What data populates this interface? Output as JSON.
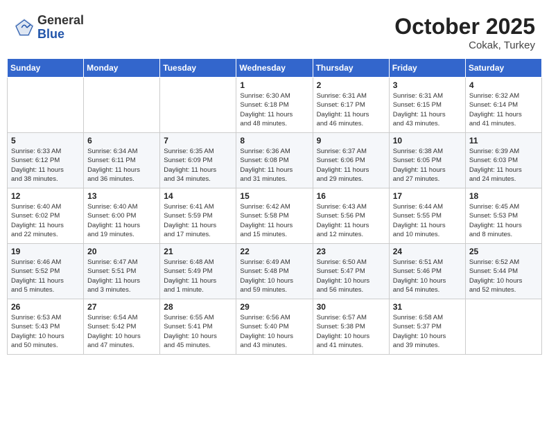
{
  "logo": {
    "general": "General",
    "blue": "Blue"
  },
  "title": "October 2025",
  "subtitle": "Cokak, Turkey",
  "days_of_week": [
    "Sunday",
    "Monday",
    "Tuesday",
    "Wednesday",
    "Thursday",
    "Friday",
    "Saturday"
  ],
  "weeks": [
    [
      {
        "day": "",
        "info": ""
      },
      {
        "day": "",
        "info": ""
      },
      {
        "day": "",
        "info": ""
      },
      {
        "day": "1",
        "info": "Sunrise: 6:30 AM\nSunset: 6:18 PM\nDaylight: 11 hours\nand 48 minutes."
      },
      {
        "day": "2",
        "info": "Sunrise: 6:31 AM\nSunset: 6:17 PM\nDaylight: 11 hours\nand 46 minutes."
      },
      {
        "day": "3",
        "info": "Sunrise: 6:31 AM\nSunset: 6:15 PM\nDaylight: 11 hours\nand 43 minutes."
      },
      {
        "day": "4",
        "info": "Sunrise: 6:32 AM\nSunset: 6:14 PM\nDaylight: 11 hours\nand 41 minutes."
      }
    ],
    [
      {
        "day": "5",
        "info": "Sunrise: 6:33 AM\nSunset: 6:12 PM\nDaylight: 11 hours\nand 38 minutes."
      },
      {
        "day": "6",
        "info": "Sunrise: 6:34 AM\nSunset: 6:11 PM\nDaylight: 11 hours\nand 36 minutes."
      },
      {
        "day": "7",
        "info": "Sunrise: 6:35 AM\nSunset: 6:09 PM\nDaylight: 11 hours\nand 34 minutes."
      },
      {
        "day": "8",
        "info": "Sunrise: 6:36 AM\nSunset: 6:08 PM\nDaylight: 11 hours\nand 31 minutes."
      },
      {
        "day": "9",
        "info": "Sunrise: 6:37 AM\nSunset: 6:06 PM\nDaylight: 11 hours\nand 29 minutes."
      },
      {
        "day": "10",
        "info": "Sunrise: 6:38 AM\nSunset: 6:05 PM\nDaylight: 11 hours\nand 27 minutes."
      },
      {
        "day": "11",
        "info": "Sunrise: 6:39 AM\nSunset: 6:03 PM\nDaylight: 11 hours\nand 24 minutes."
      }
    ],
    [
      {
        "day": "12",
        "info": "Sunrise: 6:40 AM\nSunset: 6:02 PM\nDaylight: 11 hours\nand 22 minutes."
      },
      {
        "day": "13",
        "info": "Sunrise: 6:40 AM\nSunset: 6:00 PM\nDaylight: 11 hours\nand 19 minutes."
      },
      {
        "day": "14",
        "info": "Sunrise: 6:41 AM\nSunset: 5:59 PM\nDaylight: 11 hours\nand 17 minutes."
      },
      {
        "day": "15",
        "info": "Sunrise: 6:42 AM\nSunset: 5:58 PM\nDaylight: 11 hours\nand 15 minutes."
      },
      {
        "day": "16",
        "info": "Sunrise: 6:43 AM\nSunset: 5:56 PM\nDaylight: 11 hours\nand 12 minutes."
      },
      {
        "day": "17",
        "info": "Sunrise: 6:44 AM\nSunset: 5:55 PM\nDaylight: 11 hours\nand 10 minutes."
      },
      {
        "day": "18",
        "info": "Sunrise: 6:45 AM\nSunset: 5:53 PM\nDaylight: 11 hours\nand 8 minutes."
      }
    ],
    [
      {
        "day": "19",
        "info": "Sunrise: 6:46 AM\nSunset: 5:52 PM\nDaylight: 11 hours\nand 5 minutes."
      },
      {
        "day": "20",
        "info": "Sunrise: 6:47 AM\nSunset: 5:51 PM\nDaylight: 11 hours\nand 3 minutes."
      },
      {
        "day": "21",
        "info": "Sunrise: 6:48 AM\nSunset: 5:49 PM\nDaylight: 11 hours\nand 1 minute."
      },
      {
        "day": "22",
        "info": "Sunrise: 6:49 AM\nSunset: 5:48 PM\nDaylight: 10 hours\nand 59 minutes."
      },
      {
        "day": "23",
        "info": "Sunrise: 6:50 AM\nSunset: 5:47 PM\nDaylight: 10 hours\nand 56 minutes."
      },
      {
        "day": "24",
        "info": "Sunrise: 6:51 AM\nSunset: 5:46 PM\nDaylight: 10 hours\nand 54 minutes."
      },
      {
        "day": "25",
        "info": "Sunrise: 6:52 AM\nSunset: 5:44 PM\nDaylight: 10 hours\nand 52 minutes."
      }
    ],
    [
      {
        "day": "26",
        "info": "Sunrise: 6:53 AM\nSunset: 5:43 PM\nDaylight: 10 hours\nand 50 minutes."
      },
      {
        "day": "27",
        "info": "Sunrise: 6:54 AM\nSunset: 5:42 PM\nDaylight: 10 hours\nand 47 minutes."
      },
      {
        "day": "28",
        "info": "Sunrise: 6:55 AM\nSunset: 5:41 PM\nDaylight: 10 hours\nand 45 minutes."
      },
      {
        "day": "29",
        "info": "Sunrise: 6:56 AM\nSunset: 5:40 PM\nDaylight: 10 hours\nand 43 minutes."
      },
      {
        "day": "30",
        "info": "Sunrise: 6:57 AM\nSunset: 5:38 PM\nDaylight: 10 hours\nand 41 minutes."
      },
      {
        "day": "31",
        "info": "Sunrise: 6:58 AM\nSunset: 5:37 PM\nDaylight: 10 hours\nand 39 minutes."
      },
      {
        "day": "",
        "info": ""
      }
    ]
  ]
}
